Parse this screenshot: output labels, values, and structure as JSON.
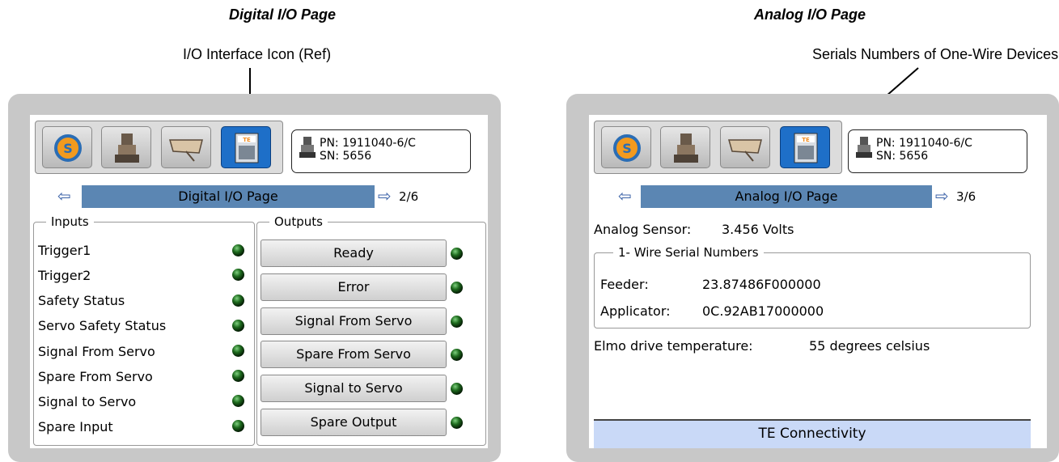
{
  "captions": {
    "digital_title": "Digital I/O Page",
    "analog_title": "Analog I/O Page",
    "digital_callout": "I/O Interface Icon (Ref)",
    "analog_callout": "Serials Numbers of One-Wire Devices"
  },
  "device": {
    "pn": "PN: 1911040-6/C",
    "sn": "SN: 5656"
  },
  "toolbar_icons": [
    "refresh-icon",
    "press-machine-icon",
    "applicator-icon",
    "io-interface-icon"
  ],
  "digital": {
    "page_label": "Digital I/O Page",
    "page_num": "2/6",
    "inputs_legend": "Inputs",
    "outputs_legend": "Outputs",
    "inputs": [
      "Trigger1",
      "Trigger2",
      "Safety Status",
      "Servo Safety Status",
      "Signal From Servo",
      "Spare From Servo",
      "Signal to Servo",
      "Spare Input"
    ],
    "outputs": [
      "Ready",
      "Error",
      "Signal From Servo",
      "Spare From Servo",
      "Signal to Servo",
      "Spare Output"
    ]
  },
  "analog": {
    "page_label": "Analog I/O Page",
    "page_num": "3/6",
    "sensor_label": "Analog Sensor:",
    "sensor_value": "3.456 Volts",
    "wire_legend": "1- Wire Serial Numbers",
    "feeder_label": "Feeder:",
    "feeder_value": "23.87486F000000",
    "applicator_label": "Applicator:",
    "applicator_value": "0C.92AB17000000",
    "temp_label": "Elmo drive temperature:",
    "temp_value": "55 degrees celsius",
    "footer": "TE Connectivity"
  },
  "colors": {
    "active_tab": "#1e6fc8",
    "page_bar": "#5b86b3",
    "footer_bg": "#c9d9f7",
    "led_green": "#1e6b1e"
  }
}
